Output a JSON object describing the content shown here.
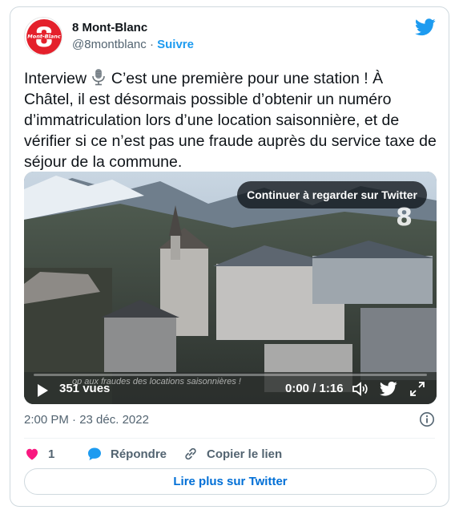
{
  "account": {
    "name": "8 Mont-Blanc",
    "handle": "@8montblanc",
    "separator": "·",
    "follow_label": "Suivre"
  },
  "tweet": {
    "text_part1": "Interview ",
    "text_part2": " C’est une première pour une station ! À Châtel, il est désormais possible d’obtenir un numéro d’immatriculation lors d’une location saisonnière, et de vérifier si ce n’est pas une fraude auprès du service taxe de séjour de la commune."
  },
  "video": {
    "continue_label": "Continuer à regarder sur Twitter",
    "watermark": "8",
    "caption_overlay": "op aux fraudes des locations saisonnières !",
    "views": "351 vues",
    "time": "0:00 / 1:16"
  },
  "meta": {
    "timestamp": "2:00 PM · 23 déc. 2022"
  },
  "actions": {
    "like_count": "1",
    "reply_label": "Répondre",
    "copy_label": "Copier le lien"
  },
  "read_more_label": "Lire plus sur Twitter",
  "colors": {
    "brand_blue": "#1d9bf0",
    "like_red": "#f91880",
    "link_blue": "#006fd6",
    "muted_gray": "#536471",
    "avatar_red": "#e4202b"
  },
  "icons": [
    "twitter-bird-icon",
    "microphone-icon",
    "play-icon",
    "volume-icon",
    "fullscreen-icon",
    "info-icon",
    "heart-icon",
    "reply-bubble-icon",
    "link-icon"
  ]
}
